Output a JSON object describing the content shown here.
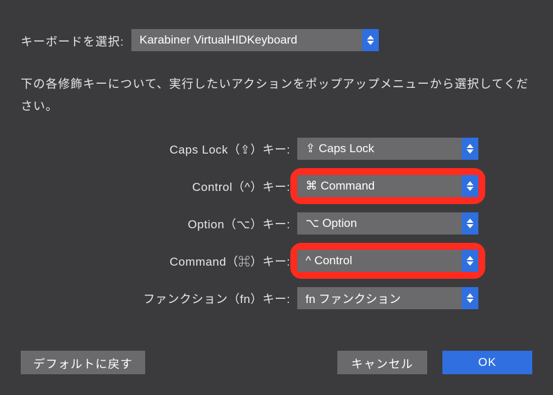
{
  "top": {
    "label": "キーボードを選択:",
    "selected": "Karabiner VirtualHIDKeyboard"
  },
  "instruction": "下の各修飾キーについて、実行したいアクションをポップアップメニューから選択してください。",
  "rows": [
    {
      "label": "Caps Lock（⇪）キー:",
      "value": "⇪ Caps Lock",
      "highlight": false
    },
    {
      "label": "Control（^）キー:",
      "value": "⌘ Command",
      "highlight": true
    },
    {
      "label": "Option（⌥）キー:",
      "value": "⌥ Option",
      "highlight": false
    },
    {
      "label": "Command（⌘）キー:",
      "value": "^ Control",
      "highlight": true
    },
    {
      "label": "ファンクション（fn）キー:",
      "value": "fn ファンクション",
      "highlight": false
    }
  ],
  "buttons": {
    "restore": "デフォルトに戻す",
    "cancel": "キャンセル",
    "ok": "OK"
  }
}
